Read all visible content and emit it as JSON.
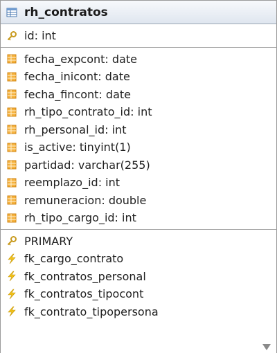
{
  "table": {
    "title": "rh_contratos",
    "title_icon": "table-icon"
  },
  "primary_key_columns": [
    {
      "label": "id: int",
      "icon": "key-icon"
    }
  ],
  "columns": [
    {
      "label": "fecha_expcont: date",
      "icon": "column-icon"
    },
    {
      "label": "fecha_inicont: date",
      "icon": "column-icon"
    },
    {
      "label": "fecha_fincont: date",
      "icon": "column-icon"
    },
    {
      "label": "rh_tipo_contrato_id: int",
      "icon": "column-icon"
    },
    {
      "label": "rh_personal_id: int",
      "icon": "column-icon"
    },
    {
      "label": "is_active: tinyint(1)",
      "icon": "column-icon"
    },
    {
      "label": "partidad: varchar(255)",
      "icon": "column-icon"
    },
    {
      "label": "reemplazo_id: int",
      "icon": "column-icon"
    },
    {
      "label": "remuneracion: double",
      "icon": "column-icon"
    },
    {
      "label": "rh_tipo_cargo_id: int",
      "icon": "column-icon"
    }
  ],
  "indexes": [
    {
      "label": "PRIMARY",
      "icon": "key-icon"
    },
    {
      "label": "fk_cargo_contrato",
      "icon": "lightning-icon"
    },
    {
      "label": "fk_contratos_personal",
      "icon": "lightning-icon"
    },
    {
      "label": "fk_contratos_tipocont",
      "icon": "lightning-icon"
    },
    {
      "label": "fk_contrato_tipopersona",
      "icon": "lightning-icon"
    }
  ],
  "colors": {
    "header_bg_top": "#f7f9fc",
    "header_bg_bottom": "#dfe6ef",
    "column_icon": "#f0a020",
    "key_icon": "#c89a1e",
    "lightning_icon": "#f2c21a"
  }
}
